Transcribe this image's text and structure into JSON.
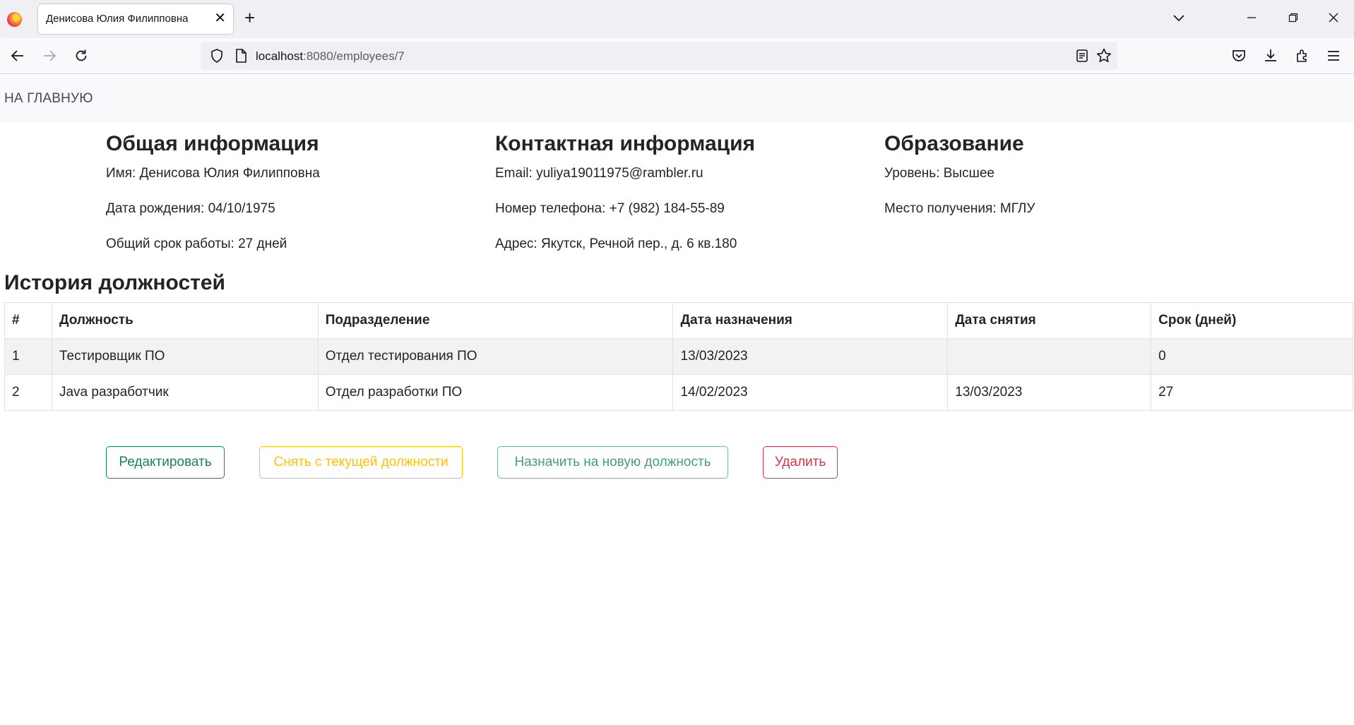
{
  "browser": {
    "tab_title": "Денисова Юлия Филипповна",
    "tab_close": "✕",
    "new_tab": "+",
    "url_host": "localhost",
    "url_rest": ":8080/employees/7"
  },
  "header": {
    "home_link": "НА ГЛАВНУЮ"
  },
  "general": {
    "title": "Общая информация",
    "name": "Имя: Денисова Юлия Филипповна",
    "birth_date": "Дата рождения: 04/10/1975",
    "total_work": "Общий срок работы: 27 дней"
  },
  "contact": {
    "title": "Контактная информация",
    "email": "Email: yuliya19011975@rambler.ru",
    "phone": "Номер телефона: +7 (982) 184-55-89",
    "address": "Адрес: Якутск, Речной пер., д. 6 кв.180"
  },
  "education": {
    "title": "Образование",
    "level": "Уровень: Высшее",
    "place": "Место получения: МГЛУ"
  },
  "history": {
    "title": "История должностей",
    "columns": [
      "#",
      "Должность",
      "Подразделение",
      "Дата назначения",
      "Дата снятия",
      "Срок (дней)"
    ],
    "rows": [
      [
        "1",
        "Тестировщик ПО",
        "Отдел тестирования ПО",
        "13/03/2023",
        "",
        "0"
      ],
      [
        "2",
        "Java разработчик",
        "Отдел разработки ПО",
        "14/02/2023",
        "13/03/2023",
        "27"
      ]
    ]
  },
  "actions": {
    "edit": "Редактировать",
    "remove_position": "Снять с текущей должности",
    "assign_position": "Назначить на новую должность",
    "delete": "Удалить"
  }
}
